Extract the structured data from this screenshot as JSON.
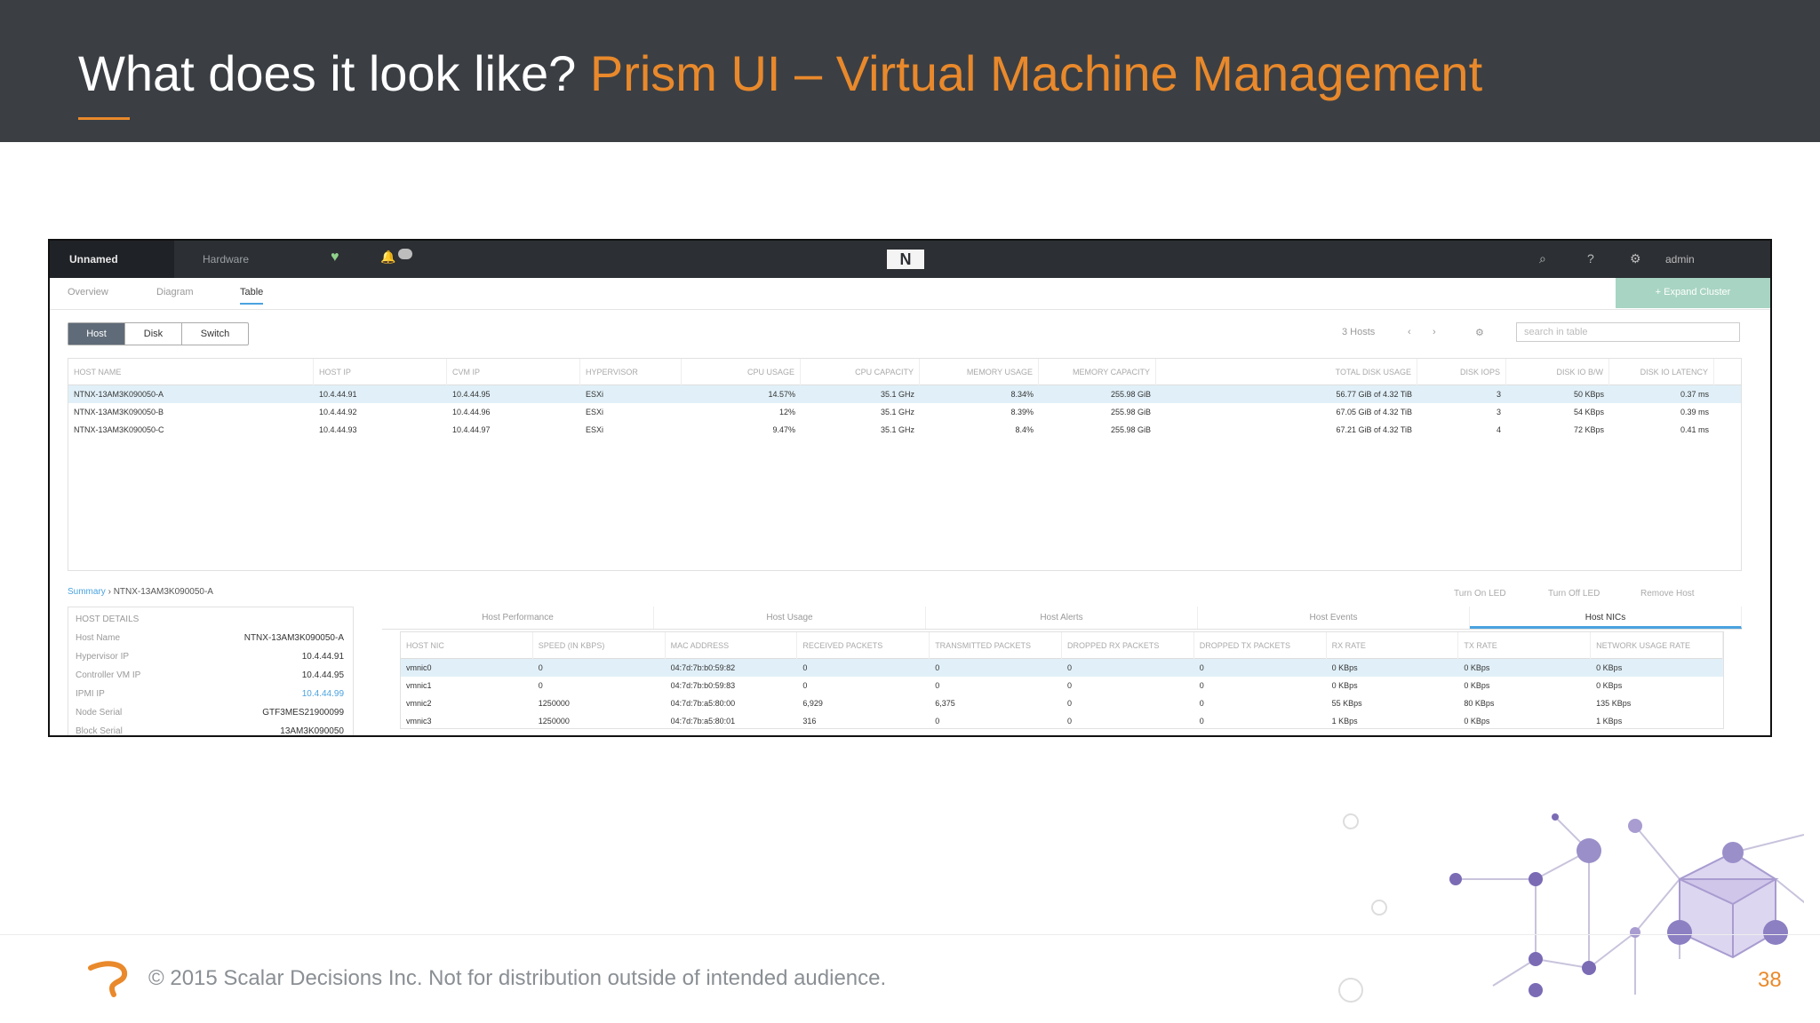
{
  "slide": {
    "title_main": "What does it look like?",
    "title_accent": "Prism UI – Virtual Machine Management",
    "footer": "© 2015 Scalar Decisions Inc. Not for distribution outside of intended audience.",
    "page_number": "38",
    "accent_color": "#e9892b",
    "header_bg": "#3b3f44"
  },
  "prism": {
    "cluster_name": "Unnamed",
    "menu": "Hardware",
    "logo": "N",
    "user": "admin",
    "subnav": [
      "Overview",
      "Diagram",
      "Table"
    ],
    "expand_cluster": "+ Expand Cluster",
    "segments": [
      "Host",
      "Disk",
      "Switch"
    ],
    "hosts_count": "3 Hosts",
    "search_placeholder": "search in table",
    "host_columns": [
      "HOST NAME",
      "HOST IP",
      "CVM IP",
      "HYPERVISOR",
      "CPU USAGE",
      "CPU CAPACITY",
      "MEMORY USAGE",
      "MEMORY CAPACITY",
      "TOTAL DISK USAGE",
      "DISK IOPS",
      "DISK IO B/W",
      "DISK IO LATENCY"
    ],
    "hosts": [
      {
        "name": "NTNX-13AM3K090050-A",
        "host_ip": "10.4.44.91",
        "cvm_ip": "10.4.44.95",
        "hypervisor": "ESXi",
        "cpu_usage": "14.57%",
        "cpu_capacity": "35.1 GHz",
        "mem_usage": "8.34%",
        "mem_capacity": "255.98 GiB",
        "disk_usage": "56.77 GiB of 4.32 TiB",
        "iops": "3",
        "bw": "50 KBps",
        "latency": "0.37 ms"
      },
      {
        "name": "NTNX-13AM3K090050-B",
        "host_ip": "10.4.44.92",
        "cvm_ip": "10.4.44.96",
        "hypervisor": "ESXi",
        "cpu_usage": "12%",
        "cpu_capacity": "35.1 GHz",
        "mem_usage": "8.39%",
        "mem_capacity": "255.98 GiB",
        "disk_usage": "67.05 GiB of 4.32 TiB",
        "iops": "3",
        "bw": "54 KBps",
        "latency": "0.39 ms"
      },
      {
        "name": "NTNX-13AM3K090050-C",
        "host_ip": "10.4.44.93",
        "cvm_ip": "10.4.44.97",
        "hypervisor": "ESXi",
        "cpu_usage": "9.47%",
        "cpu_capacity": "35.1 GHz",
        "mem_usage": "8.4%",
        "mem_capacity": "255.98 GiB",
        "disk_usage": "67.21 GiB of 4.32 TiB",
        "iops": "4",
        "bw": "72 KBps",
        "latency": "0.41 ms"
      }
    ],
    "summary_link": "Summary",
    "summary_host": "NTNX-13AM3K090050-A",
    "actions": [
      "Turn On LED",
      "Turn Off LED",
      "Remove Host"
    ],
    "details_title": "HOST DETAILS",
    "details": [
      {
        "k": "Host Name",
        "v": "NTNX-13AM3K090050-A"
      },
      {
        "k": "Hypervisor IP",
        "v": "10.4.44.91"
      },
      {
        "k": "Controller VM IP",
        "v": "10.4.44.95"
      },
      {
        "k": "IPMI IP",
        "v": "10.4.44.99"
      },
      {
        "k": "Node Serial",
        "v": "GTF3MES21900099"
      },
      {
        "k": "Block Serial",
        "v": "13AM3K090050"
      }
    ],
    "tabs": [
      "Host Performance",
      "Host Usage",
      "Host Alerts",
      "Host Events",
      "Host NICs"
    ],
    "nic_columns": [
      "HOST NIC",
      "SPEED (IN KBPS)",
      "MAC ADDRESS",
      "RECEIVED PACKETS",
      "TRANSMITTED PACKETS",
      "DROPPED RX PACKETS",
      "DROPPED TX PACKETS",
      "RX RATE",
      "TX RATE",
      "NETWORK USAGE RATE"
    ],
    "nics": [
      [
        "vmnic0",
        "0",
        "04:7d:7b:b0:59:82",
        "0",
        "0",
        "0",
        "0",
        "0 KBps",
        "0 KBps",
        "0 KBps"
      ],
      [
        "vmnic1",
        "0",
        "04:7d:7b:b0:59:83",
        "0",
        "0",
        "0",
        "0",
        "0 KBps",
        "0 KBps",
        "0 KBps"
      ],
      [
        "vmnic2",
        "1250000",
        "04:7d:7b:a5:80:00",
        "6,929",
        "6,375",
        "0",
        "0",
        "55 KBps",
        "80 KBps",
        "135 KBps"
      ],
      [
        "vmnic3",
        "1250000",
        "04:7d:7b:a5:80:01",
        "316",
        "0",
        "0",
        "0",
        "1 KBps",
        "0 KBps",
        "1 KBps"
      ]
    ]
  }
}
